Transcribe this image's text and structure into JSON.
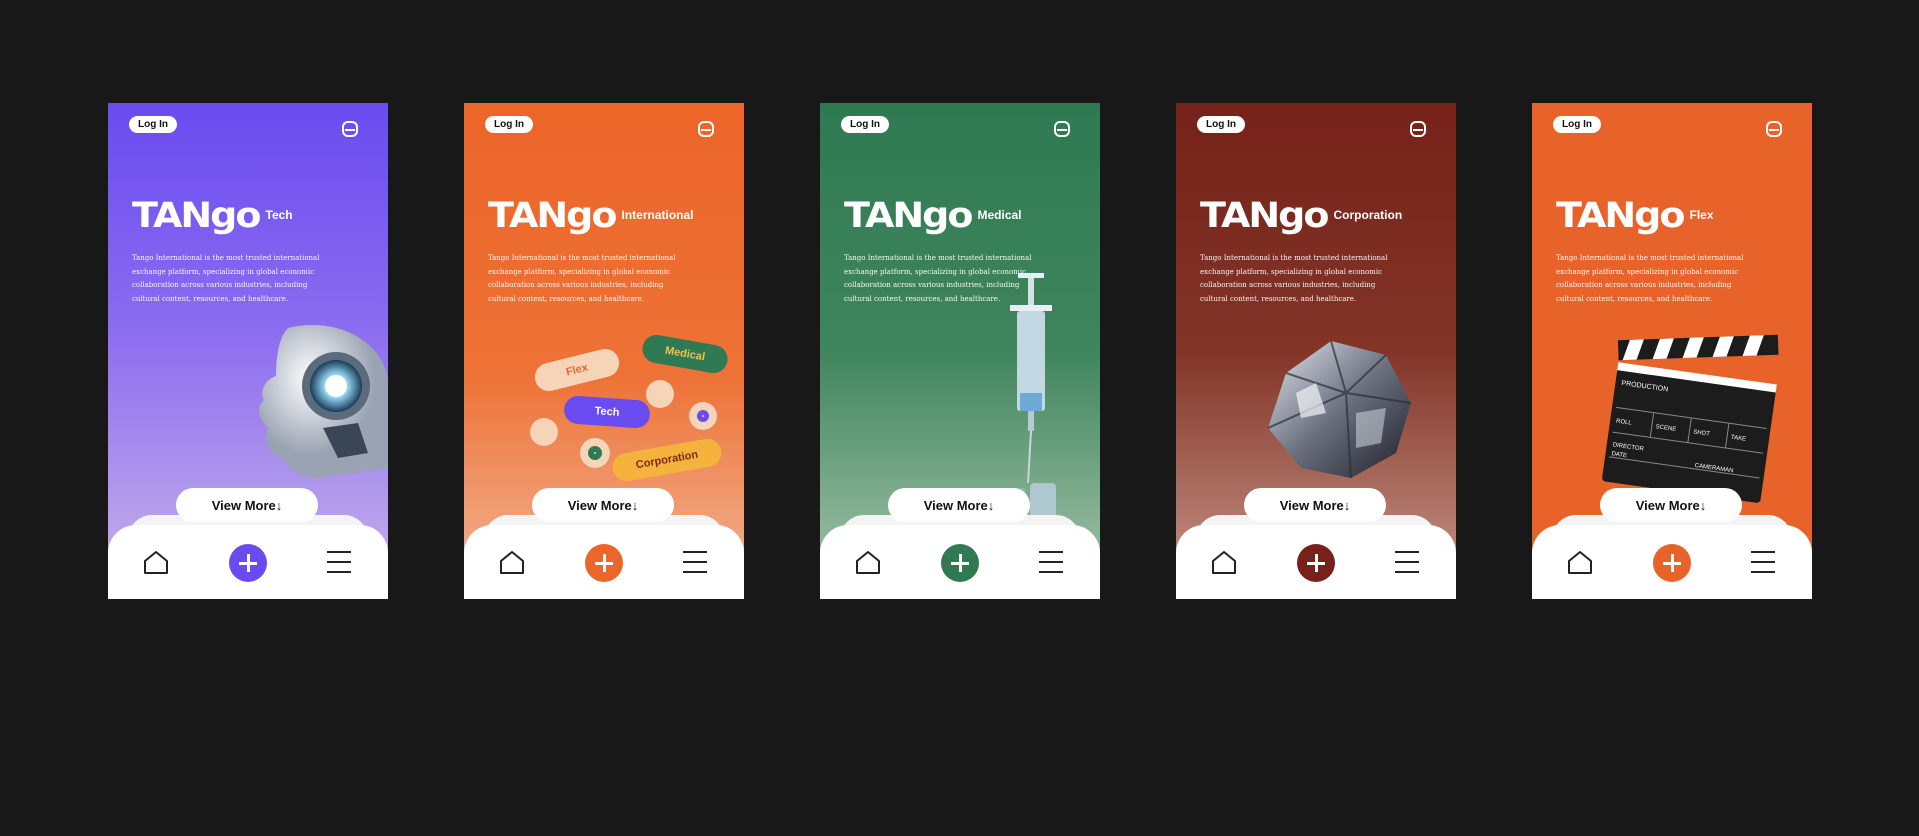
{
  "screens": [
    {
      "login": "Log In",
      "brand": "TANgo",
      "subtitle": "Tech",
      "description": "Tango International is the most trusted international exchange platform, specializing in global economic collaboration across various industries, including cultural content, resources, and healthcare.",
      "view_more": "View More↓",
      "accent": "#6a4bef",
      "art": "robot-head-image"
    },
    {
      "login": "Log In",
      "brand": "TANgo",
      "subtitle": "International",
      "description": "Tango International is the most trusted international exchange platform, specializing in global economic collaboration across various industries, including cultural content, resources, and healthcare.",
      "view_more": "View More↓",
      "accent": "#ec6529",
      "art": "category-stickers",
      "stickers": [
        "Flex",
        "Medical",
        "Tech",
        "Corporation"
      ]
    },
    {
      "login": "Log In",
      "brand": "TANgo",
      "subtitle": "Medical",
      "description": "Tango International is the most trusted international exchange platform, specializing in global economic collaboration across various industries, including cultural content, resources, and healthcare.",
      "view_more": "View More↓",
      "accent": "#2f7a52",
      "art": "syringe-image"
    },
    {
      "login": "Log In",
      "brand": "TANgo",
      "subtitle": "Corporation",
      "description": "Tango International is the most trusted international exchange platform, specializing in global economic collaboration across various industries, including cultural content, resources, and healthcare.",
      "view_more": "View More↓",
      "accent": "#76221a",
      "art": "mineral-rock-image"
    },
    {
      "login": "Log In",
      "brand": "TANgo",
      "subtitle": "Flex",
      "description": "Tango International is the most trusted international exchange platform, specializing in global economic collaboration across various industries, including cultural content, resources, and healthcare.",
      "view_more": "View More↓",
      "accent": "#e8632a",
      "art": "clapperboard-image",
      "clapper_labels": [
        "PRODUCTION",
        "ROLL",
        "SCENE",
        "SHOT",
        "TAKE",
        "DIRECTOR",
        "DATE",
        "CAMERAMAN"
      ]
    }
  ],
  "nav": {
    "home_icon": "home-icon",
    "add_icon": "plus-icon",
    "menu_icon": "hamburger-menu-icon"
  }
}
